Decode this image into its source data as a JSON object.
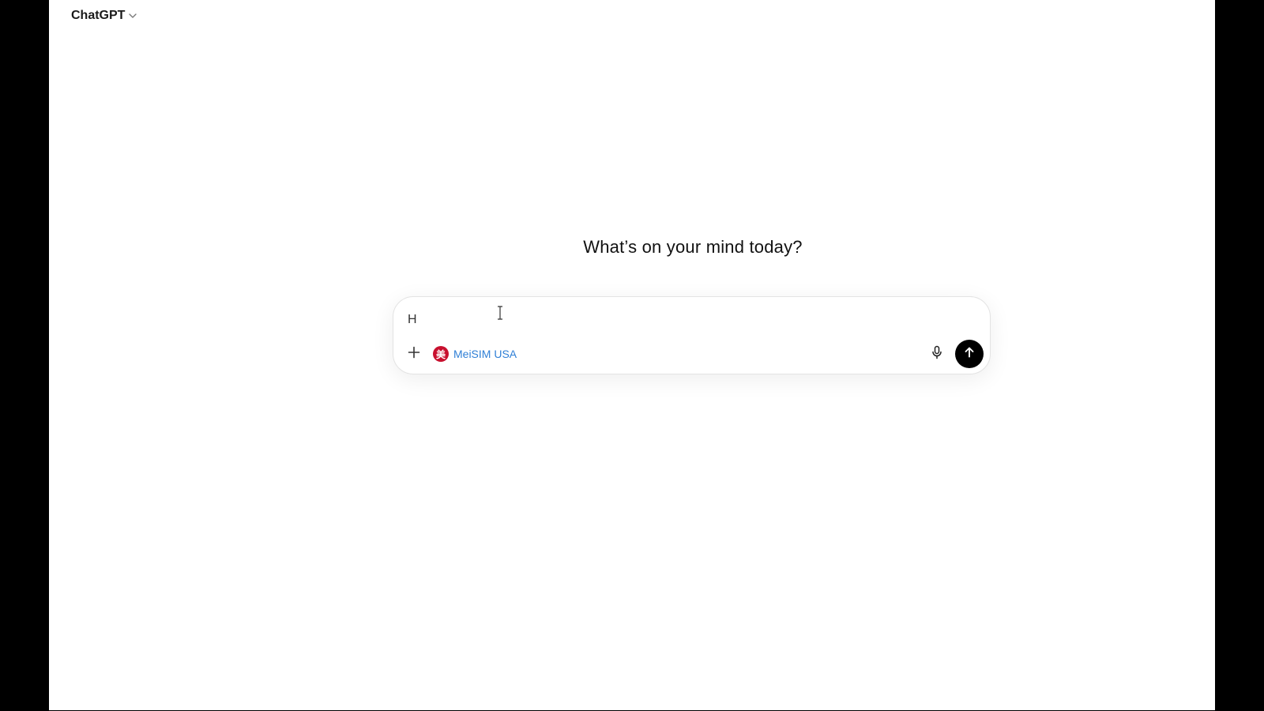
{
  "header": {
    "model_name": "ChatGPT",
    "chevron_icon": "chevron-down-icon"
  },
  "main": {
    "headline": "What’s on your mind today?"
  },
  "composer": {
    "input_value": "H",
    "tool_chip": {
      "label": "MeiSIM USA",
      "logo_glyph": "美",
      "logo_color": "#c8102e",
      "label_color": "#2f7fd6"
    },
    "icons": {
      "plus": "plus-icon",
      "mic": "microphone-icon",
      "send": "arrow-up-icon"
    }
  }
}
